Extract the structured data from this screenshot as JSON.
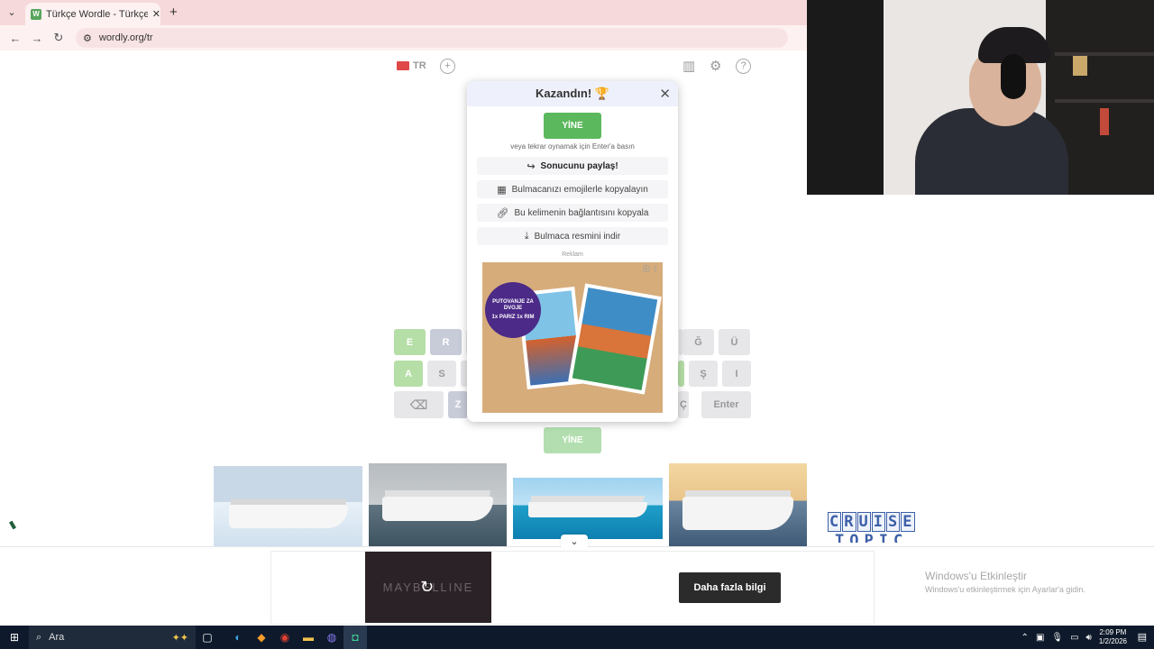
{
  "browser": {
    "tab_title": "Türkçe Wordle - Türkçe Kelime",
    "favicon_letter": "W",
    "url": "wordly.org/tr"
  },
  "header": {
    "lang": "TR"
  },
  "keyboard": {
    "row1": [
      "E",
      "R",
      "Ğ",
      "Ü"
    ],
    "row2": [
      "A",
      "S",
      "Ş",
      "I"
    ],
    "row3": [
      "Z",
      "Ç",
      "Enter"
    ]
  },
  "modal": {
    "title": "Kazandın! 🏆",
    "again_label": "YİNE",
    "hint": "veya tekrar oynamak için Enter'a basın",
    "share_label": "Sonucunu paylaş!",
    "copy_emoji_label": "Bulmacanızı emojilerle kopyalayın",
    "copy_link_label": "Bu kelimenin bağlantısını kopyala",
    "download_label": "Bulmaca resmini indir",
    "ad_label": "Reklam",
    "ad_badge_line1": "PUTOVANJE ZA DVOJE",
    "ad_badge_line2": "1x PARIZ 1x RIM"
  },
  "again_below": "YİNE",
  "cruise_logo": {
    "line1": [
      "C",
      "R",
      "U",
      "I",
      "S",
      "E"
    ],
    "line2": "TOPIC"
  },
  "bottom_ad": {
    "video_brand": "MAYBELLINE",
    "cta": "Daha fazla bilgi"
  },
  "windows_activation": {
    "title": "Windows'u Etkinleştir",
    "subtitle": "Windows'u etkinleştirmek için Ayarlar'a gidin."
  },
  "taskbar": {
    "search_placeholder": "Ara",
    "time": "2:09 PM",
    "date": "1/2/2026"
  }
}
